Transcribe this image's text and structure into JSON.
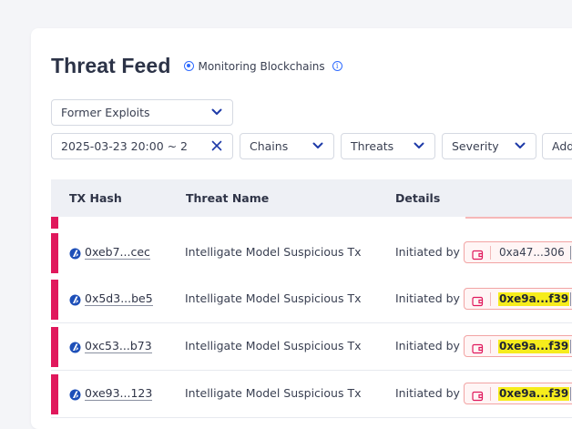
{
  "header": {
    "title": "Threat Feed",
    "monitoring_label": "Monitoring Blockchains"
  },
  "filters": {
    "category": "Former Exploits",
    "date_range": "2025-03-23 20:00 ~ 2",
    "chains": "Chains",
    "threats": "Threats",
    "severity": "Severity",
    "add": "Add"
  },
  "table": {
    "columns": [
      "TX Hash",
      "Threat Name",
      "Details"
    ],
    "initiated_label": "Initiated by",
    "rows": [
      {
        "tx_hash": "0xeb7...cec",
        "threat_name": "Intelligate Model Suspicious Tx",
        "initiator": "0xa47...306",
        "highlighted": false
      },
      {
        "tx_hash": "0x5d3...be5",
        "threat_name": "Intelligate Model Suspicious Tx",
        "initiator": "0xe9a...f39",
        "highlighted": true
      },
      {
        "tx_hash": "0xc53...b73",
        "threat_name": "Intelligate Model Suspicious Tx",
        "initiator": "0xe9a...f39",
        "highlighted": true
      },
      {
        "tx_hash": "0xe93...123",
        "threat_name": "Intelligate Model Suspicious Tx",
        "initiator": "0xe9a...f39",
        "highlighted": true
      }
    ]
  },
  "colors": {
    "accent": "#2f6bff",
    "severity_bar": "#e0185c",
    "highlight": "#f6ec1c"
  }
}
